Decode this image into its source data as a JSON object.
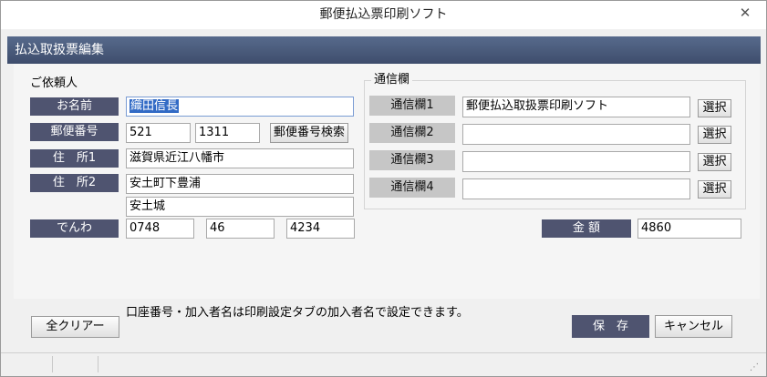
{
  "window": {
    "title": "郵便払込票印刷ソフト",
    "close_glyph": "✕"
  },
  "header": {
    "title": "払込取扱票編集"
  },
  "requester": {
    "section_label": "ご依頼人",
    "name": {
      "label": "お名前",
      "value": "織田信長"
    },
    "postal": {
      "label": "郵便番号",
      "part1": "521",
      "part2": "1311",
      "search_button": "郵便番号検索"
    },
    "address1": {
      "label": "住　所1",
      "value": "滋賀県近江八幡市"
    },
    "address2": {
      "label": "住　所2",
      "value": "安土町下豊浦",
      "value_line2": "安土城"
    },
    "phone": {
      "label": "でんわ",
      "part1": "0748",
      "part2": "46",
      "part3": "4234"
    }
  },
  "message": {
    "group_label": "通信欄",
    "rows": [
      {
        "label": "通信欄1",
        "value": "郵便払込取扱票印刷ソフト",
        "button": "選択"
      },
      {
        "label": "通信欄2",
        "value": "",
        "button": "選択"
      },
      {
        "label": "通信欄3",
        "value": "",
        "button": "選択"
      },
      {
        "label": "通信欄4",
        "value": "",
        "button": "選択"
      }
    ]
  },
  "amount": {
    "label": "金 額",
    "value": "4860"
  },
  "footer": {
    "note": "口座番号・加入者名は印刷設定タブの加入者名で設定できます。",
    "clear_button": "全クリアー",
    "save_button": "保　存",
    "cancel_button": "キャンセル"
  },
  "colors": {
    "header_bg": "#4a5a7a",
    "dark_label": "#4f5470",
    "gray_label": "#c6c6c6",
    "selection": "#316ac5"
  }
}
